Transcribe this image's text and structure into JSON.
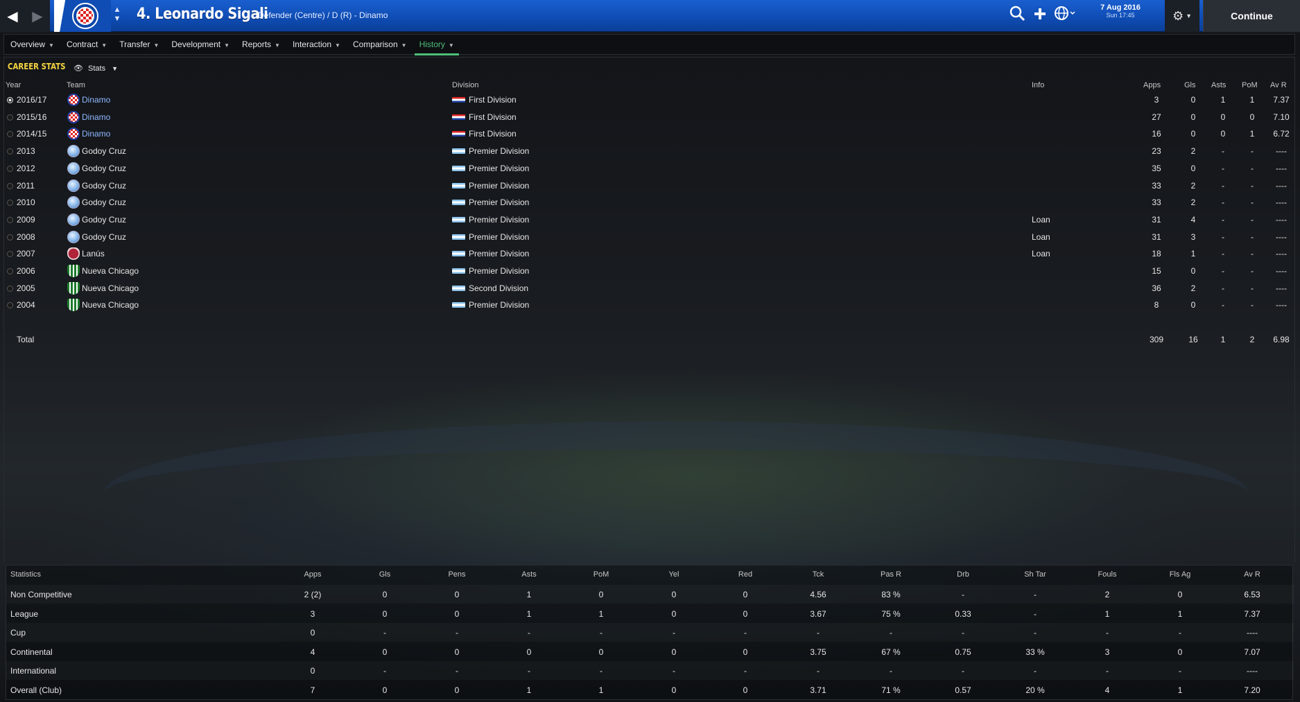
{
  "topbar": {
    "player_name": "4. Leonardo Sigali",
    "player_sub": "Defender (Centre) / D (R) - Dinamo",
    "date": "7 Aug 2016",
    "time": "Sun 17:45",
    "continue_label": "Continue"
  },
  "tabs": [
    "Overview",
    "Contract",
    "Transfer",
    "Development",
    "Reports",
    "Interaction",
    "Comparison",
    "History"
  ],
  "active_tab": "History",
  "career": {
    "title": "CAREER STATS",
    "view_label": "Stats",
    "headers": {
      "year": "Year",
      "team": "Team",
      "division": "Division",
      "info": "Info",
      "apps": "Apps",
      "gls": "Gls",
      "asts": "Asts",
      "pom": "PoM",
      "avr": "Av R"
    },
    "rows": [
      {
        "year": "2016/17",
        "team": "Dinamo",
        "division": "First Division",
        "info": "",
        "apps": "3",
        "gls": "0",
        "asts": "1",
        "pom": "1",
        "avr": "7.37"
      },
      {
        "year": "2015/16",
        "team": "Dinamo",
        "division": "First Division",
        "info": "",
        "apps": "27",
        "gls": "0",
        "asts": "0",
        "pom": "0",
        "avr": "7.10"
      },
      {
        "year": "2014/15",
        "team": "Dinamo",
        "division": "First Division",
        "info": "",
        "apps": "16",
        "gls": "0",
        "asts": "0",
        "pom": "1",
        "avr": "6.72"
      },
      {
        "year": "2013",
        "team": "Godoy Cruz",
        "division": "Premier Division",
        "info": "",
        "apps": "23",
        "gls": "2",
        "asts": "-",
        "pom": "-",
        "avr": "----"
      },
      {
        "year": "2012",
        "team": "Godoy Cruz",
        "division": "Premier Division",
        "info": "",
        "apps": "35",
        "gls": "0",
        "asts": "-",
        "pom": "-",
        "avr": "----"
      },
      {
        "year": "2011",
        "team": "Godoy Cruz",
        "division": "Premier Division",
        "info": "",
        "apps": "33",
        "gls": "2",
        "asts": "-",
        "pom": "-",
        "avr": "----"
      },
      {
        "year": "2010",
        "team": "Godoy Cruz",
        "division": "Premier Division",
        "info": "",
        "apps": "33",
        "gls": "2",
        "asts": "-",
        "pom": "-",
        "avr": "----"
      },
      {
        "year": "2009",
        "team": "Godoy Cruz",
        "division": "Premier Division",
        "info": "Loan",
        "apps": "31",
        "gls": "4",
        "asts": "-",
        "pom": "-",
        "avr": "----"
      },
      {
        "year": "2008",
        "team": "Godoy Cruz",
        "division": "Premier Division",
        "info": "Loan",
        "apps": "31",
        "gls": "3",
        "asts": "-",
        "pom": "-",
        "avr": "----"
      },
      {
        "year": "2007",
        "team": "Lanús",
        "division": "Premier Division",
        "info": "Loan",
        "apps": "18",
        "gls": "1",
        "asts": "-",
        "pom": "-",
        "avr": "----"
      },
      {
        "year": "2006",
        "team": "Nueva Chicago",
        "division": "Premier Division",
        "info": "",
        "apps": "15",
        "gls": "0",
        "asts": "-",
        "pom": "-",
        "avr": "----"
      },
      {
        "year": "2005",
        "team": "Nueva Chicago",
        "division": "Second Division",
        "info": "",
        "apps": "36",
        "gls": "2",
        "asts": "-",
        "pom": "-",
        "avr": "----"
      },
      {
        "year": "2004",
        "team": "Nueva Chicago",
        "division": "Premier Division",
        "info": "",
        "apps": "8",
        "gls": "0",
        "asts": "-",
        "pom": "-",
        "avr": "----"
      }
    ],
    "total": {
      "label": "Total",
      "apps": "309",
      "gls": "16",
      "asts": "1",
      "pom": "2",
      "avr": "6.98"
    }
  },
  "stats": {
    "headers": [
      "Statistics",
      "Apps",
      "Gls",
      "Pens",
      "Asts",
      "PoM",
      "Yel",
      "Red",
      "Tck",
      "Pas R",
      "Drb",
      "Sh Tar",
      "Fouls",
      "Fls Ag",
      "Av R"
    ],
    "rows": [
      [
        "Non Competitive",
        "2 (2)",
        "0",
        "0",
        "1",
        "0",
        "0",
        "0",
        "4.56",
        "83 %",
        "-",
        "-",
        "2",
        "0",
        "6.53"
      ],
      [
        "League",
        "3",
        "0",
        "0",
        "1",
        "1",
        "0",
        "0",
        "3.67",
        "75 %",
        "0.33",
        "-",
        "1",
        "1",
        "7.37"
      ],
      [
        "Cup",
        "0",
        "-",
        "-",
        "-",
        "-",
        "-",
        "-",
        "-",
        "-",
        "-",
        "-",
        "-",
        "-",
        "----"
      ],
      [
        "Continental",
        "4",
        "0",
        "0",
        "0",
        "0",
        "0",
        "0",
        "3.75",
        "67 %",
        "0.75",
        "33 %",
        "3",
        "0",
        "7.07"
      ],
      [
        "International",
        "0",
        "-",
        "-",
        "-",
        "-",
        "-",
        "-",
        "-",
        "-",
        "-",
        "-",
        "-",
        "-",
        "----"
      ],
      [
        "Overall (Club)",
        "7",
        "0",
        "0",
        "1",
        "1",
        "0",
        "0",
        "3.71",
        "71 %",
        "0.57",
        "20 %",
        "4",
        "1",
        "7.20"
      ]
    ]
  }
}
